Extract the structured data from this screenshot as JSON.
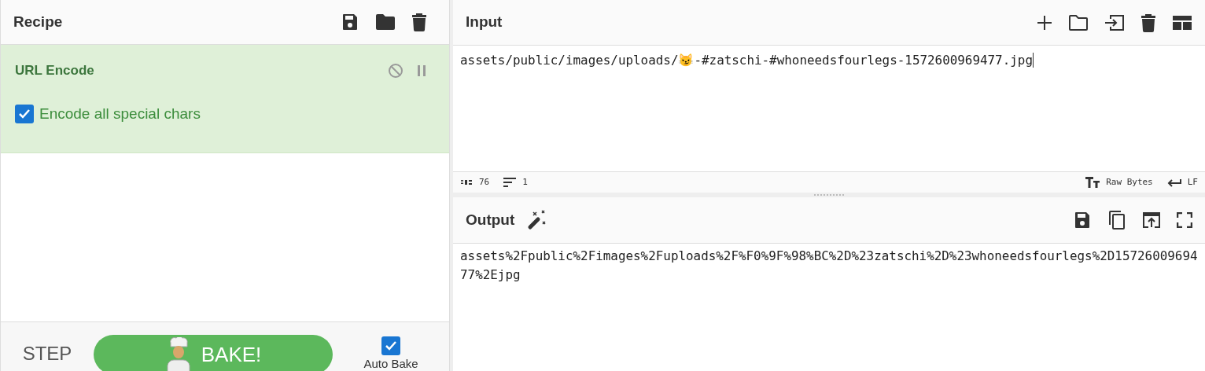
{
  "recipe": {
    "title": "Recipe",
    "operations": [
      {
        "name": "URL Encode",
        "options": [
          {
            "label": "Encode all special chars",
            "checked": true
          }
        ]
      }
    ]
  },
  "controls": {
    "step": "STEP",
    "bake": "BAKE!",
    "auto_bake": {
      "label": "Auto Bake",
      "checked": true
    }
  },
  "input": {
    "title": "Input",
    "value": "assets/public/images/uploads/😼-#zatschi-#whoneedsfourlegs-1572600969477.jpg",
    "length": "76",
    "lines": "1",
    "encoding": "Raw Bytes",
    "eol": "LF"
  },
  "output": {
    "title": "Output",
    "value": "assets%2Fpublic%2Fimages%2Fuploads%2F%F0%9F%98%BC%2D%23zatschi%2D%23whoneedsfourlegs%2D1572600969477%2Ejpg"
  }
}
